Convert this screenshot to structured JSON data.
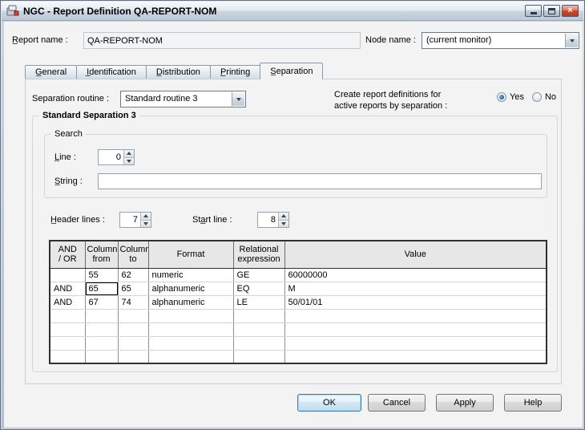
{
  "window": {
    "title": "NGC - Report Definition QA-REPORT-NOM"
  },
  "icons": {
    "close_glyph": "×"
  },
  "colors": {
    "close_button_red": "#c2402a",
    "selection_accent_blue": "#1a5c9e",
    "default_button_border_blue": "#3a7bab"
  },
  "header": {
    "report_name_label": "R̲eport name :",
    "report_name_value": "QA-REPORT-NOM",
    "node_name_label": "Node name :",
    "node_name_value": "(current monitor)"
  },
  "tabs": [
    {
      "label": "G̲eneral"
    },
    {
      "label": "I̲dentification"
    },
    {
      "label": "D̲istribution"
    },
    {
      "label": "P̲rinting"
    },
    {
      "label": "S̲eparation"
    }
  ],
  "separation_page": {
    "routine_label": "Separation routine :",
    "routine_value": "Standard routine 3",
    "create_line1": "Create report definitions for",
    "create_line2": "active reports by separation :",
    "radio_yes": "Yes",
    "radio_no": "No",
    "group_title": "Standard Separation 3",
    "search_group_title": "Search",
    "line_label": "L̲ine :",
    "line_value": "0",
    "string_label": "S̲tring :",
    "string_value": "",
    "header_lines_label": "H̲eader lines :",
    "header_lines_value": "7",
    "start_line_label": "Sta̲rt line :",
    "start_line_value": "8"
  },
  "table": {
    "headers": [
      "AND\n/ OR",
      "Column\nfrom",
      "Column\nto",
      "Format",
      "Relational\nexpression",
      "Value"
    ],
    "rows": [
      [
        "",
        "55",
        "62",
        "numeric",
        "GE",
        "60000000"
      ],
      [
        "AND",
        "65",
        "65",
        "alphanumeric",
        "EQ",
        "M"
      ],
      [
        "AND",
        "67",
        "74",
        "alphanumeric",
        "LE",
        "50/01/01"
      ],
      [
        "",
        "",
        "",
        "",
        "",
        ""
      ],
      [
        "",
        "",
        "",
        "",
        "",
        ""
      ],
      [
        "",
        "",
        "",
        "",
        "",
        ""
      ],
      [
        "",
        "",
        "",
        "",
        "",
        ""
      ]
    ],
    "focused_cell": {
      "row": 1,
      "col": 1
    }
  },
  "footer": {
    "ok_label": "OK",
    "cancel_label": "Cancel",
    "apply_label": "Apply",
    "help_label": "Help"
  }
}
